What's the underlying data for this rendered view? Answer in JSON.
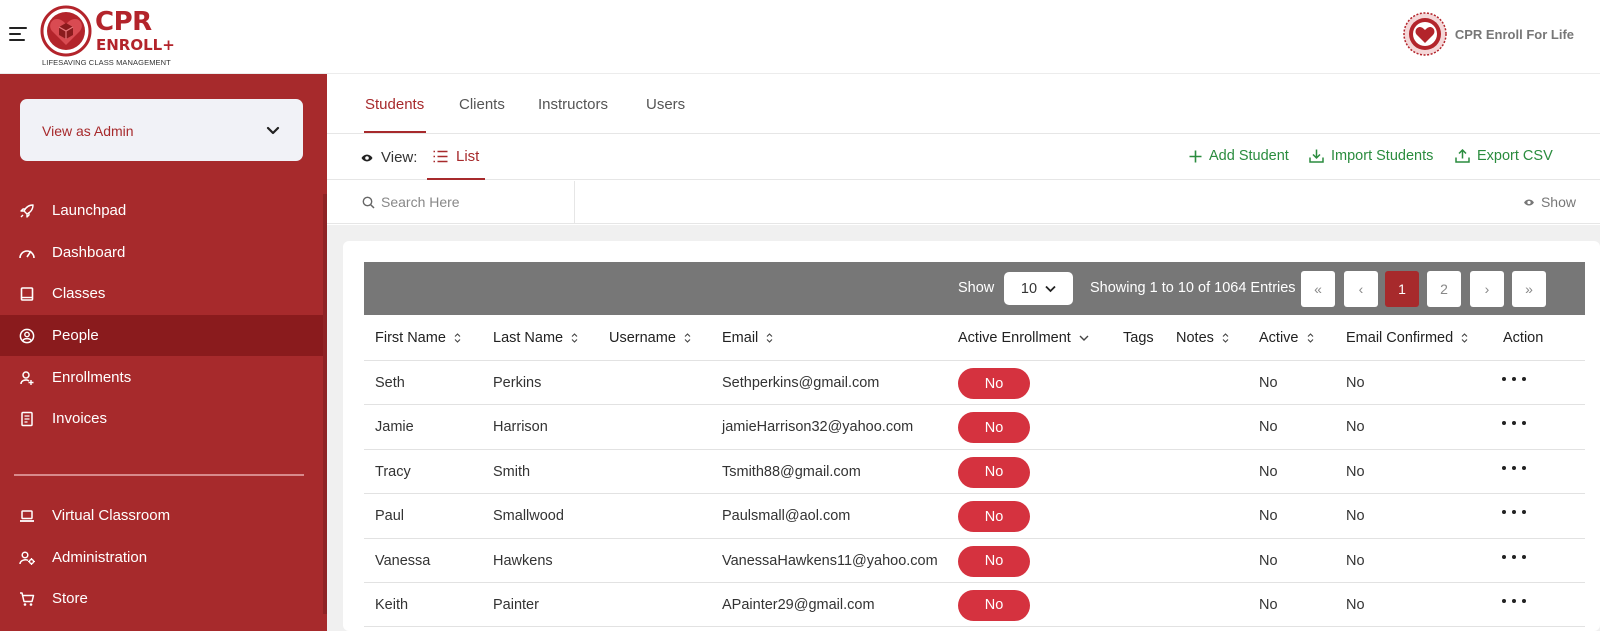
{
  "brand": {
    "logo_line1": "CPR",
    "logo_line2": "ENROLL",
    "logo_plus": "+",
    "tagline": "LIFESAVING CLASS MANAGEMENT",
    "org_name": "CPR Enroll For Life",
    "accent_color": "#a72a2c"
  },
  "sidebar": {
    "view_as": "View as Admin",
    "items": [
      {
        "label": "Launchpad",
        "icon": "rocket-icon"
      },
      {
        "label": "Dashboard",
        "icon": "gauge-icon"
      },
      {
        "label": "Classes",
        "icon": "book-icon"
      },
      {
        "label": "People",
        "icon": "user-circle-icon",
        "active": true
      },
      {
        "label": "Enrollments",
        "icon": "user-add-icon"
      },
      {
        "label": "Invoices",
        "icon": "receipt-icon"
      },
      {
        "label": "Virtual Classroom",
        "icon": "laptop-icon"
      },
      {
        "label": "Administration",
        "icon": "user-gear-icon"
      },
      {
        "label": "Store",
        "icon": "cart-icon"
      }
    ]
  },
  "tabs": [
    {
      "label": "Students",
      "active": true
    },
    {
      "label": "Clients"
    },
    {
      "label": "Instructors"
    },
    {
      "label": "Users"
    }
  ],
  "toolbar": {
    "view_label": "View:",
    "list_label": "List",
    "add_student": "Add Student",
    "import_students": "Import Students",
    "export_csv": "Export CSV"
  },
  "search": {
    "placeholder": "Search Here",
    "show_label": "Show"
  },
  "pager": {
    "show_label": "Show",
    "page_size": "10",
    "info": "Showing 1 to 10 of 1064 Entries",
    "first": "«",
    "prev": "‹",
    "pages": [
      "1",
      "2"
    ],
    "current_page": "1",
    "next": "›",
    "last": "»"
  },
  "table": {
    "columns": [
      "First Name",
      "Last Name",
      "Username",
      "Email",
      "Active Enrollment",
      "Tags",
      "Notes",
      "Active",
      "Email Confirmed",
      "Action"
    ],
    "rows": [
      {
        "first": "Seth",
        "last": "Perkins",
        "username": "",
        "email": "Sethperkins@gmail.com",
        "enrollment": "No",
        "active": "No",
        "confirmed": "No"
      },
      {
        "first": "Jamie",
        "last": "Harrison",
        "username": "",
        "email": "jamieHarrison32@yahoo.com",
        "enrollment": "No",
        "active": "No",
        "confirmed": "No"
      },
      {
        "first": "Tracy",
        "last": "Smith",
        "username": "",
        "email": "Tsmith88@gmail.com",
        "enrollment": "No",
        "active": "No",
        "confirmed": "No"
      },
      {
        "first": "Paul",
        "last": "Smallwood",
        "username": "",
        "email": "Paulsmall@aol.com",
        "enrollment": "No",
        "active": "No",
        "confirmed": "No"
      },
      {
        "first": "Vanessa",
        "last": "Hawkens",
        "username": "",
        "email": "VanessaHawkens11@yahoo.com",
        "enrollment": "No",
        "active": "No",
        "confirmed": "No"
      },
      {
        "first": "Keith",
        "last": "Painter",
        "username": "",
        "email": "APainter29@gmail.com",
        "enrollment": "No",
        "active": "No",
        "confirmed": "No"
      }
    ]
  }
}
